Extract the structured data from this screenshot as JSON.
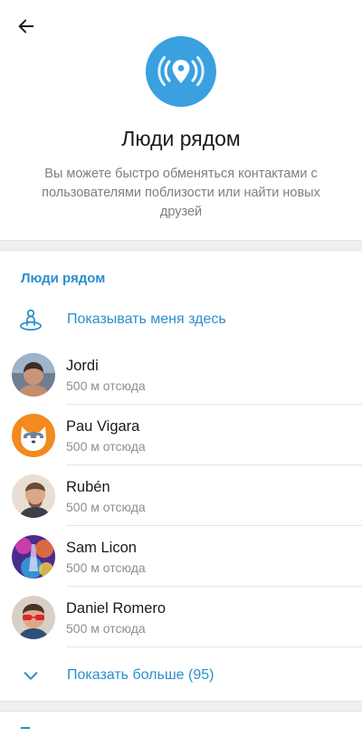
{
  "header": {
    "back_icon": "arrow-left-icon"
  },
  "hero": {
    "icon": "location-broadcast-icon",
    "icon_bg": "#3aa0e0",
    "title": "Люди рядом",
    "description": "Вы можете быстро обменяться контактами с пользователями поблизости или найти новых друзей"
  },
  "nearby": {
    "section_title": "Люди рядом",
    "show_me_label": "Показывать меня здесь",
    "show_me_icon": "person-location-icon",
    "people": [
      {
        "name": "Jordi",
        "distance": "500 м отсюда"
      },
      {
        "name": "Pau Vigara",
        "distance": "500 м отсюда"
      },
      {
        "name": "Rubén",
        "distance": "500 м отсюда"
      },
      {
        "name": "Sam Licon",
        "distance": "500 м отсюда"
      },
      {
        "name": "Daniel Romero",
        "distance": "500 м отсюда"
      }
    ],
    "show_more_label": "Показать больше (95)",
    "show_more_icon": "chevron-down-icon"
  },
  "colors": {
    "accent": "#2b8fce",
    "secondary_text": "#8a8f95",
    "divider": "#f0f0f0"
  }
}
